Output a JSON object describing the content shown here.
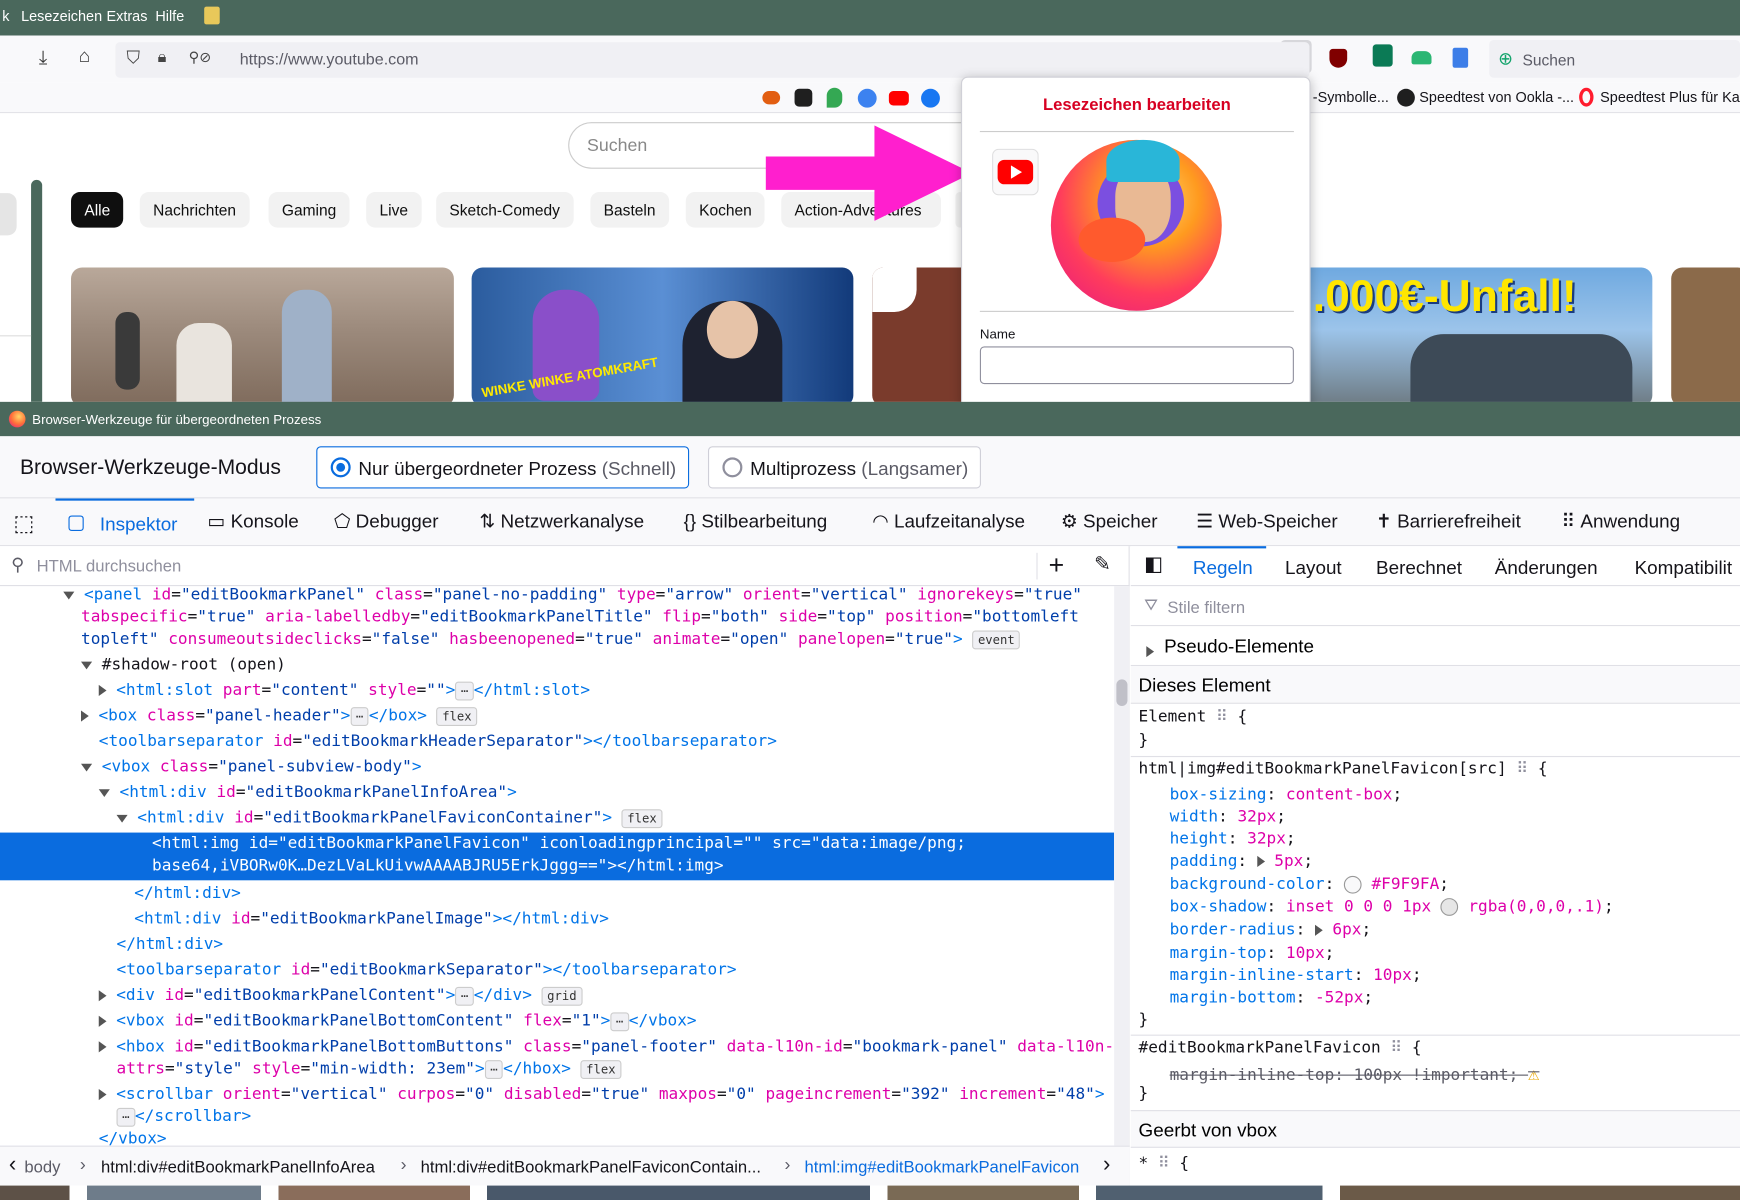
{
  "menubar": {
    "items": [
      "k",
      "Lesezeichen",
      "Extras",
      "Hilfe"
    ]
  },
  "navbar": {
    "url": "https://www.youtube.com",
    "search_label": "Suchen"
  },
  "bookmarks": {
    "items": [
      "-Symbolle...",
      "Speedtest von Ookla -...",
      "Speedtest Plus für Kab..."
    ]
  },
  "youtube": {
    "search_placeholder": "Suchen",
    "chips": [
      "Alle",
      "Nachrichten",
      "Gaming",
      "Live",
      "Sketch-Comedy",
      "Basteln",
      "Kochen",
      "Action-Adventures"
    ],
    "thumb_text_2": "WINKE WINKE ATOMKRAFT",
    "thumb_text_4": ".000€-Unfall!"
  },
  "bookmark_panel": {
    "title": "Lesezeichen bearbeiten",
    "name_label": "Name",
    "name_value": ""
  },
  "devtools": {
    "window_title": "Browser-Werkzeuge für übergeordneten Prozess",
    "mode_label": "Browser-Werkzeuge-Modus",
    "mode_parent": "Nur übergeordneter Prozess",
    "mode_parent_hint": "(Schnell)",
    "mode_multi": "Multiprozess",
    "mode_multi_hint": "(Langsamer)",
    "tabs": [
      "Inspektor",
      "Konsole",
      "Debugger",
      "Netzwerkanalyse",
      "Stilbearbeitung",
      "Laufzeitanalyse",
      "Speicher",
      "Web-Speicher",
      "Barrierefreiheit",
      "Anwendung"
    ],
    "html_search_placeholder": "HTML durchsuchen",
    "rule_tabs": [
      "Regeln",
      "Layout",
      "Berechnet",
      "Änderungen",
      "Kompatibilit"
    ],
    "style_filter_placeholder": "Stile filtern",
    "pseudo_elements": "Pseudo-Elemente",
    "this_element": "Dieses Element",
    "inherited": "Geerbt von vbox",
    "breadcrumbs": [
      "body",
      "html:div#editBookmarkPanelInfoArea",
      "html:div#editBookmarkPanelFaviconContain...",
      "html:img#editBookmarkPanelFavicon"
    ]
  },
  "colors": {
    "chrome_green": "#4a685c",
    "selection_blue": "#0a6cdf",
    "arrow_magenta": "#ff1fce",
    "yt_red": "#ff0000",
    "panel_title_red": "#d70022"
  }
}
